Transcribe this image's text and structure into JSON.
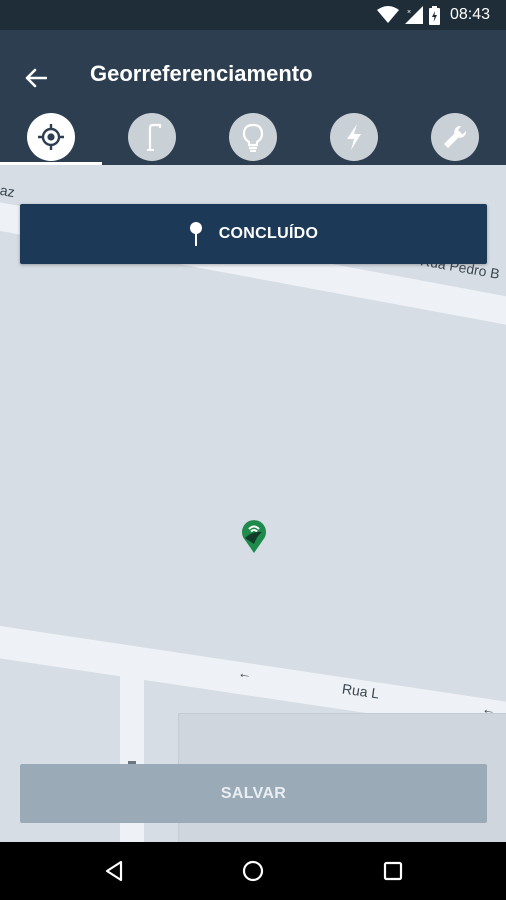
{
  "status": {
    "time": "08:43",
    "icons": [
      "wifi-icon",
      "signal-icon",
      "battery-icon"
    ]
  },
  "appbar": {
    "title": "Georreferenciamento",
    "back_icon": "arrow-back-icon"
  },
  "tabs": [
    {
      "icon": "gps-target-icon",
      "active": true
    },
    {
      "icon": "street-lamp-icon",
      "active": false
    },
    {
      "icon": "lightbulb-icon",
      "active": false
    },
    {
      "icon": "lightning-icon",
      "active": false
    },
    {
      "icon": "wrench-icon",
      "active": false
    }
  ],
  "map": {
    "street_labels": [
      "az",
      "Rua Pedro B",
      "Rua L"
    ]
  },
  "concluido": {
    "label": "CONCLUÍDO",
    "icon": "pin-icon"
  },
  "salvar": {
    "label": "SALVAR"
  },
  "colors": {
    "appbar": "#2c3e50",
    "button_primary": "#1c3a57",
    "button_disabled": "#9aabb7",
    "pin": "#1e8a4c"
  }
}
